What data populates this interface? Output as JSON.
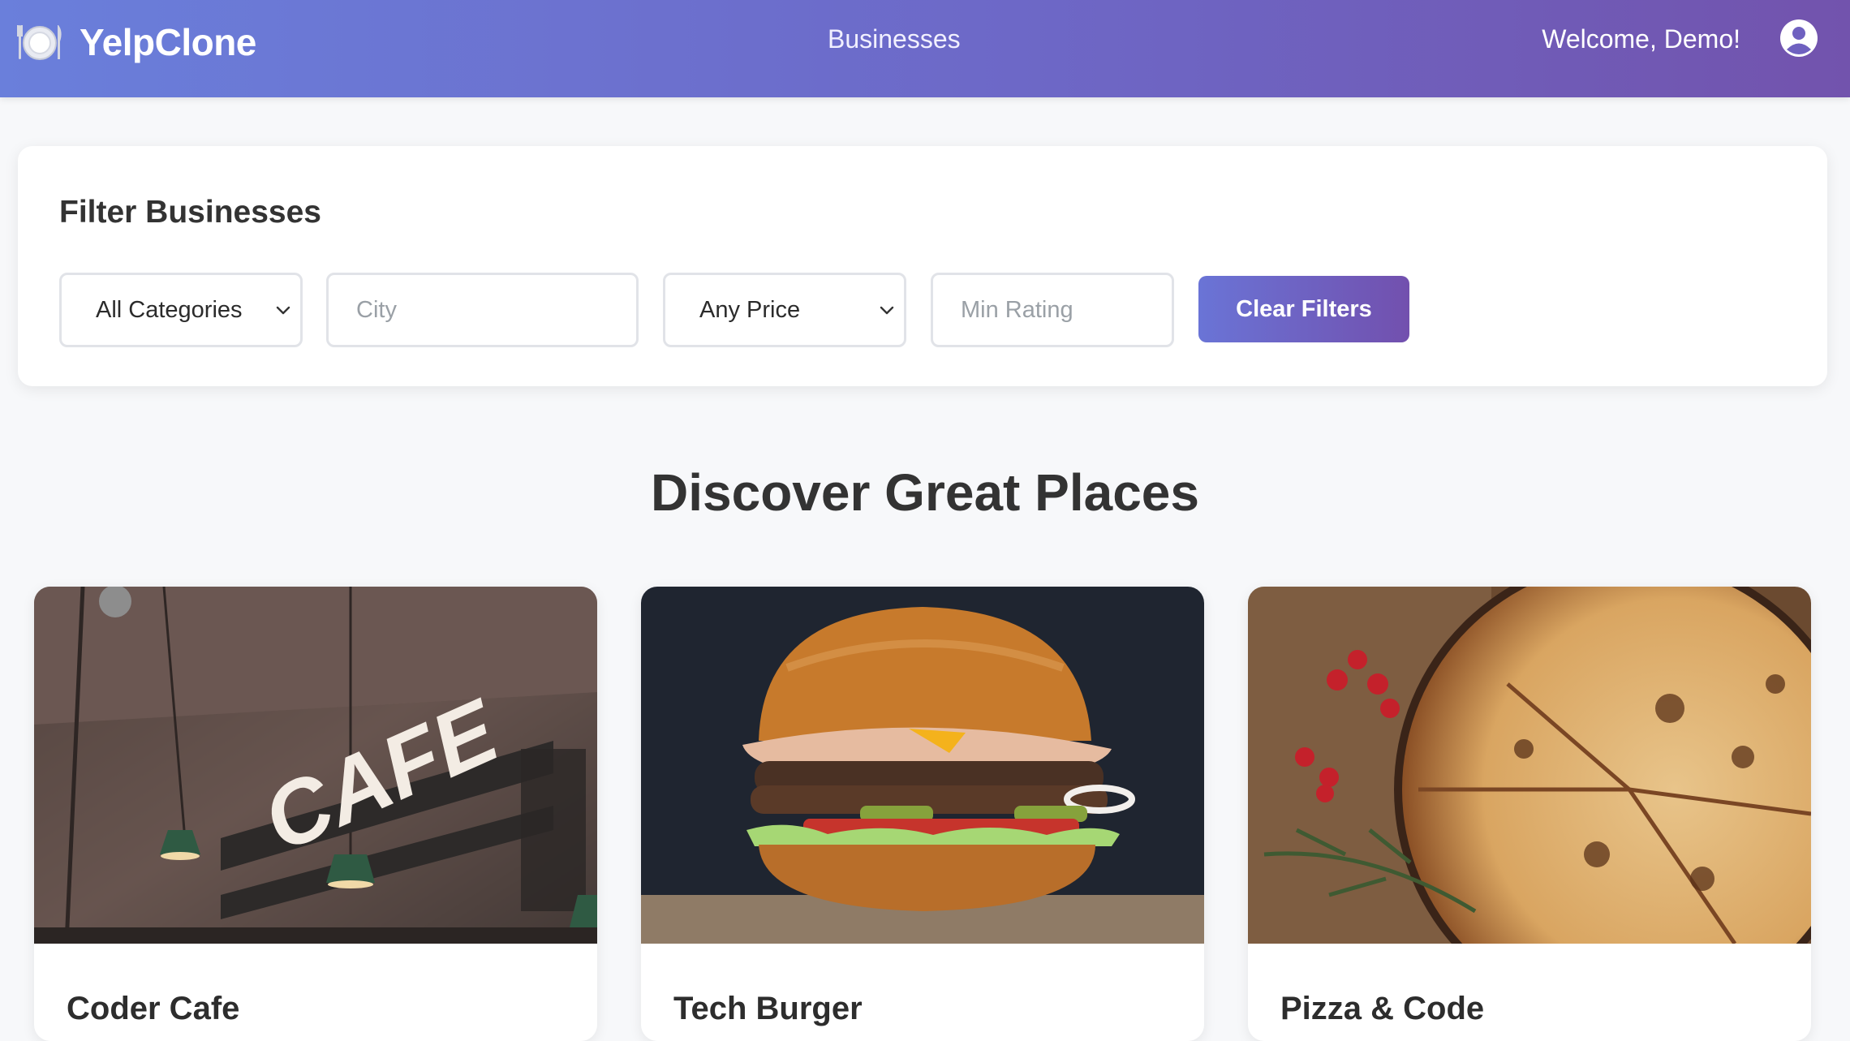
{
  "header": {
    "brand_name": "YelpClone",
    "brand_icon": "plate-cutlery-icon",
    "nav_link": "Businesses",
    "welcome_text": "Welcome, Demo!",
    "user_icon": "user-circle-icon"
  },
  "filters": {
    "title": "Filter Businesses",
    "category_select": "All Categories",
    "city_placeholder": "City",
    "price_select": "Any Price",
    "rating_placeholder": "Min Rating",
    "clear_button": "Clear Filters"
  },
  "main": {
    "heading": "Discover Great Places",
    "businesses": [
      {
        "name": "Coder Cafe",
        "image": "cafe-interior-photo"
      },
      {
        "name": "Tech Burger",
        "image": "burger-photo"
      },
      {
        "name": "Pizza & Code",
        "image": "pizza-photo"
      }
    ]
  },
  "colors": {
    "header_gradient_start": "#6a7fdb",
    "header_gradient_end": "#7253ad",
    "button_gradient_start": "#6a74d6",
    "button_gradient_end": "#7250ae",
    "page_background": "#f7f8fa"
  }
}
